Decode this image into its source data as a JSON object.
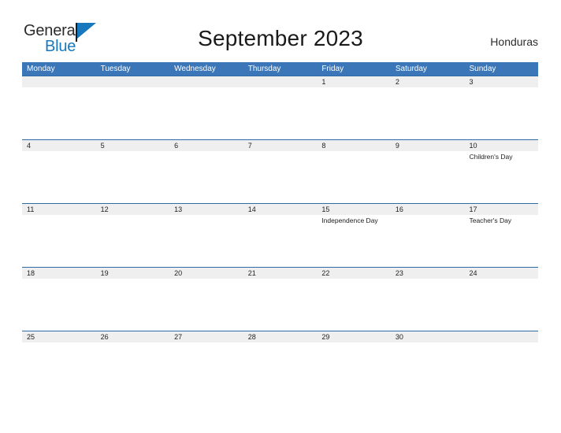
{
  "brand": {
    "name_part1": "General",
    "name_part2": "Blue",
    "flag_icon": "flag-icon",
    "color_primary": "#1878be"
  },
  "header": {
    "title": "September 2023",
    "country": "Honduras"
  },
  "calendar": {
    "header_color": "#3a76b8",
    "date_band_color": "#efefef",
    "separator_color": "#2f6ca6",
    "weekdays": [
      "Monday",
      "Tuesday",
      "Wednesday",
      "Thursday",
      "Friday",
      "Saturday",
      "Sunday"
    ],
    "weeks": [
      [
        {
          "date": "",
          "event": ""
        },
        {
          "date": "",
          "event": ""
        },
        {
          "date": "",
          "event": ""
        },
        {
          "date": "",
          "event": ""
        },
        {
          "date": "1",
          "event": ""
        },
        {
          "date": "2",
          "event": ""
        },
        {
          "date": "3",
          "event": ""
        }
      ],
      [
        {
          "date": "4",
          "event": ""
        },
        {
          "date": "5",
          "event": ""
        },
        {
          "date": "6",
          "event": ""
        },
        {
          "date": "7",
          "event": ""
        },
        {
          "date": "8",
          "event": ""
        },
        {
          "date": "9",
          "event": ""
        },
        {
          "date": "10",
          "event": "Children's Day"
        }
      ],
      [
        {
          "date": "11",
          "event": ""
        },
        {
          "date": "12",
          "event": ""
        },
        {
          "date": "13",
          "event": ""
        },
        {
          "date": "14",
          "event": ""
        },
        {
          "date": "15",
          "event": "Independence Day"
        },
        {
          "date": "16",
          "event": ""
        },
        {
          "date": "17",
          "event": "Teacher's Day"
        }
      ],
      [
        {
          "date": "18",
          "event": ""
        },
        {
          "date": "19",
          "event": ""
        },
        {
          "date": "20",
          "event": ""
        },
        {
          "date": "21",
          "event": ""
        },
        {
          "date": "22",
          "event": ""
        },
        {
          "date": "23",
          "event": ""
        },
        {
          "date": "24",
          "event": ""
        }
      ],
      [
        {
          "date": "25",
          "event": ""
        },
        {
          "date": "26",
          "event": ""
        },
        {
          "date": "27",
          "event": ""
        },
        {
          "date": "28",
          "event": ""
        },
        {
          "date": "29",
          "event": ""
        },
        {
          "date": "30",
          "event": ""
        },
        {
          "date": "",
          "event": ""
        }
      ]
    ]
  }
}
